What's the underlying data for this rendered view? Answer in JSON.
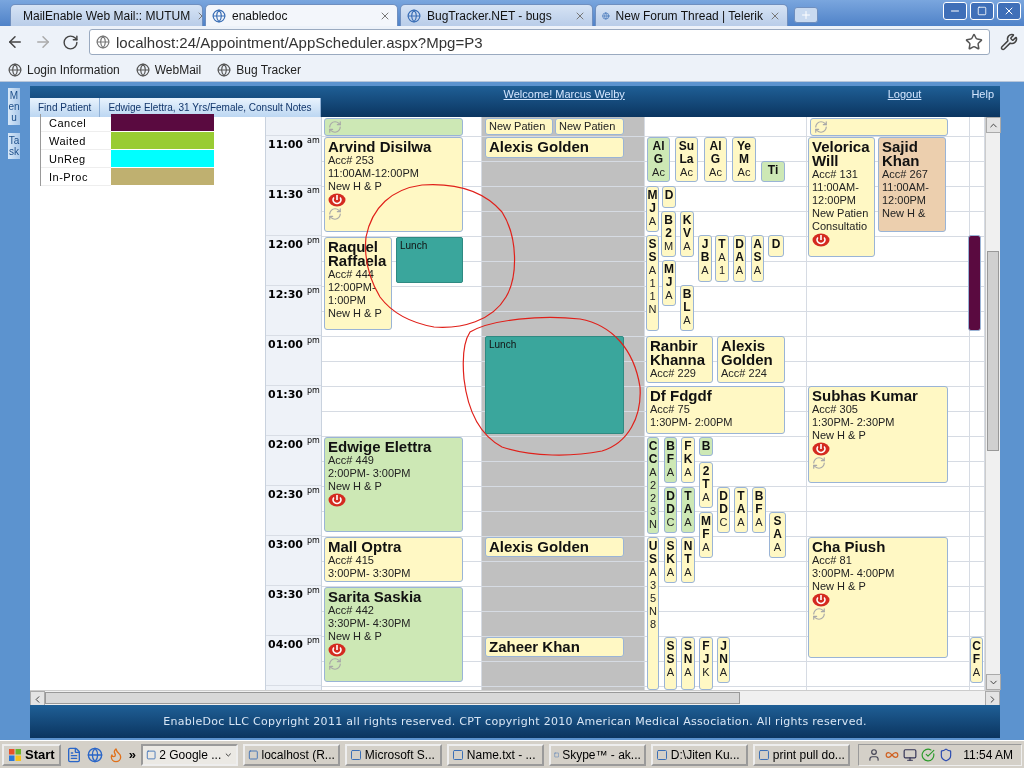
{
  "browser": {
    "tabs": [
      {
        "title": "MailEnable Web Mail:: MUTUM",
        "selected": false
      },
      {
        "title": "enabledoc",
        "selected": true
      },
      {
        "title": "BugTracker.NET - bugs",
        "selected": false
      },
      {
        "title": "New Forum Thread | Telerik",
        "selected": false
      }
    ],
    "url": "localhost:24/Appointment/AppScheduler.aspx?Mpg=P3",
    "bookmarks": [
      "Login Information",
      "WebMail",
      "Bug Tracker"
    ]
  },
  "side_strip": [
    "Menu",
    "Task"
  ],
  "header": {
    "links": [
      "Find Patient",
      "Edwige Elettra, 31 Yrs/Female, Consult Notes"
    ],
    "welcome": "Welcome! Marcus Welby",
    "logout": "Logout",
    "help": "Help"
  },
  "legend": [
    {
      "label": "Cancel",
      "color": "#5a0a40"
    },
    {
      "label": "Waited",
      "color": "#99cc33"
    },
    {
      "label": "UnReg",
      "color": "#00ffff"
    },
    {
      "label": "In-Proc",
      "color": "#bfb070"
    }
  ],
  "time_slots": [
    {
      "time": "11:00",
      "period": "am"
    },
    {
      "time": "11:30",
      "period": "am"
    },
    {
      "time": "12:00",
      "period": "pm"
    },
    {
      "time": "12:30",
      "period": "pm"
    },
    {
      "time": "01:00",
      "period": "pm"
    },
    {
      "time": "01:30",
      "period": "pm"
    },
    {
      "time": "02:00",
      "period": "pm"
    },
    {
      "time": "02:30",
      "period": "pm"
    },
    {
      "time": "03:00",
      "period": "pm"
    },
    {
      "time": "03:30",
      "period": "pm"
    },
    {
      "time": "04:00",
      "period": "pm"
    }
  ],
  "appointments": [
    {
      "kind": "card",
      "color": "#cde8b5",
      "alert": false,
      "recurring": true
    },
    {
      "kind": "card",
      "color": "#fff8c4",
      "details": [
        "New Patien"
      ],
      "alert": false,
      "recurring": false
    },
    {
      "kind": "card",
      "color": "#fff8c4",
      "details": [
        "New Patien"
      ],
      "alert": false,
      "recurring": false
    },
    {
      "kind": "card",
      "color": "#fff8c4",
      "alert": false,
      "recurring": true
    },
    {
      "kind": "card",
      "color": "#fff8c4",
      "name": "Arvind Disilwa",
      "details": [
        "Acc# 253",
        "11:00AM-12:00PM",
        "New H & P"
      ],
      "alert": true,
      "recurring": true
    },
    {
      "kind": "card",
      "color": "#fff8c4",
      "name": "Alexis Golden",
      "alert": false,
      "recurring": false
    },
    {
      "kind": "mini",
      "color": "#cde8b5",
      "name_lines": [
        "Al",
        "G"
      ],
      "detail_lines": [
        "Ac"
      ]
    },
    {
      "kind": "mini",
      "color": "#fff8c4",
      "name_lines": [
        "Su",
        "La"
      ],
      "detail_lines": [
        "Ac"
      ]
    },
    {
      "kind": "mini",
      "color": "#fff8c4",
      "name_lines": [
        "Al",
        "G"
      ],
      "detail_lines": [
        "Ac"
      ]
    },
    {
      "kind": "mini",
      "color": "#fff8c4",
      "name_lines": [
        "Ye",
        "M"
      ],
      "detail_lines": [
        "Ac"
      ]
    },
    {
      "kind": "mini",
      "color": "#cde8b5",
      "name_lines": [
        "Ti"
      ]
    },
    {
      "kind": "card",
      "color": "#fff8c4",
      "name": "Velorica Will",
      "details": [
        "Acc# 131",
        "11:00AM-12:00PM",
        "New Patien",
        "Consultatio"
      ],
      "alert": true,
      "recurring": false
    },
    {
      "kind": "card",
      "color": "#eccfae",
      "name": "Sajid Khan",
      "details": [
        "Acc# 267",
        "11:00AM-12:00PM",
        "New H &"
      ],
      "alert": false,
      "recurring": false
    },
    {
      "kind": "mini",
      "color": "#fff8c4",
      "name_lines": [
        "M",
        "J"
      ],
      "detail_lines": [
        "A"
      ]
    },
    {
      "kind": "mini",
      "color": "#fff8c4",
      "name_lines": [
        "D"
      ]
    },
    {
      "kind": "mini",
      "color": "#fff8c4",
      "name_lines": [
        "B",
        "2"
      ],
      "detail_lines": [
        "M"
      ]
    },
    {
      "kind": "mini",
      "color": "#fff8c4",
      "name_lines": [
        "K",
        "V"
      ],
      "detail_lines": [
        "A"
      ]
    },
    {
      "kind": "card",
      "color": "#fff8c4",
      "name": "Raquel Raffaela",
      "details": [
        "Acc# 444",
        "12:00PM-1:00PM",
        "New H & P"
      ],
      "alert": false,
      "recurring": false
    },
    {
      "kind": "lunch",
      "color": "#3aa69c",
      "label": "Lunch"
    },
    {
      "kind": "mini",
      "color": "#fff8c4",
      "name_lines": [
        "S",
        "S"
      ],
      "detail_lines": [
        "A",
        "1",
        "1",
        "N"
      ]
    },
    {
      "kind": "mini",
      "color": "#fff8c4",
      "name_lines": [
        "M",
        "J"
      ],
      "detail_lines": [
        "A"
      ]
    },
    {
      "kind": "mini",
      "color": "#fff8c4",
      "name_lines": [
        "J",
        "B"
      ],
      "detail_lines": [
        "A"
      ]
    },
    {
      "kind": "mini",
      "color": "#fff8c4",
      "name_lines": [
        "T"
      ],
      "detail_lines": [
        "A",
        "1"
      ]
    },
    {
      "kind": "mini",
      "color": "#fff8c4",
      "name_lines": [
        "D",
        "A"
      ],
      "detail_lines": [
        "A"
      ]
    },
    {
      "kind": "mini",
      "color": "#fff8c4",
      "name_lines": [
        "A",
        "S"
      ],
      "detail_lines": [
        "A"
      ]
    },
    {
      "kind": "mini",
      "color": "#fff8c4",
      "name_lines": [
        "D"
      ]
    },
    {
      "kind": "mini",
      "color": "#fff8c4",
      "name_lines": [
        "B",
        "L"
      ],
      "detail_lines": [
        "A"
      ]
    },
    {
      "kind": "mini",
      "color": "#5a0a40"
    },
    {
      "kind": "lunch",
      "color": "#3aa69c",
      "label": "Lunch"
    },
    {
      "kind": "card",
      "color": "#fff8c4",
      "name": "Ranbir Khanna",
      "details": [
        "Acc# 229"
      ],
      "alert": false,
      "recurring": false
    },
    {
      "kind": "card",
      "color": "#fff8c4",
      "name": "Alexis Golden",
      "details": [
        "Acc# 224"
      ],
      "alert": false,
      "recurring": false
    },
    {
      "kind": "card",
      "color": "#fff8c4",
      "name": "Df Fdgdf",
      "details": [
        "Acc# 75",
        "1:30PM- 2:00PM"
      ],
      "alert": false,
      "recurring": false
    },
    {
      "kind": "card",
      "color": "#fff8c4",
      "name": "Subhas Kumar",
      "details": [
        "Acc# 305",
        "1:30PM- 2:30PM",
        "New H & P"
      ],
      "alert": true,
      "recurring": true
    },
    {
      "kind": "card",
      "color": "#cde8b5",
      "name": "Edwige Elettra",
      "details": [
        "Acc# 449",
        "2:00PM- 3:00PM",
        "New H & P"
      ],
      "alert": true,
      "recurring": false
    },
    {
      "kind": "mini",
      "color": "#cde8b5",
      "name_lines": [
        "C",
        "C"
      ],
      "detail_lines": [
        "A",
        "2",
        "2",
        "3",
        "N"
      ]
    },
    {
      "kind": "mini",
      "color": "#cde8b5",
      "name_lines": [
        "B",
        "F"
      ],
      "detail_lines": [
        "A"
      ]
    },
    {
      "kind": "mini",
      "color": "#fff8c4",
      "name_lines": [
        "F",
        "K"
      ],
      "detail_lines": [
        "A"
      ]
    },
    {
      "kind": "mini",
      "color": "#cde8b5",
      "name_lines": [
        "B"
      ]
    },
    {
      "kind": "mini",
      "color": "#fff8c4",
      "name_lines": [
        "2",
        "T"
      ],
      "detail_lines": [
        "A"
      ]
    },
    {
      "kind": "mini",
      "color": "#cde8b5",
      "name_lines": [
        "D",
        "D"
      ],
      "detail_lines": [
        "C"
      ]
    },
    {
      "kind": "mini",
      "color": "#cde8b5",
      "name_lines": [
        "T",
        "A"
      ],
      "detail_lines": [
        "A"
      ]
    },
    {
      "kind": "mini",
      "color": "#fff8c4",
      "name_lines": [
        "M",
        "F"
      ],
      "detail_lines": [
        "A"
      ]
    },
    {
      "kind": "mini",
      "color": "#fff8c4",
      "name_lines": [
        "D",
        "D"
      ],
      "detail_lines": [
        "C"
      ]
    },
    {
      "kind": "mini",
      "color": "#fff8c4",
      "name_lines": [
        "T",
        "A"
      ],
      "detail_lines": [
        "A"
      ]
    },
    {
      "kind": "mini",
      "color": "#fff8c4",
      "name_lines": [
        "B",
        "F"
      ],
      "detail_lines": [
        "A"
      ]
    },
    {
      "kind": "mini",
      "color": "#fff8c4",
      "name_lines": [
        "S",
        "A"
      ],
      "detail_lines": [
        "A"
      ]
    },
    {
      "kind": "card",
      "color": "#fff8c4",
      "name": "Mall Optra",
      "details": [
        "Acc# 415",
        "3:00PM- 3:30PM"
      ],
      "alert": false,
      "recurring": false
    },
    {
      "kind": "card",
      "color": "#fff8c4",
      "name": "Alexis Golden",
      "alert": false,
      "recurring": false
    },
    {
      "kind": "mini",
      "color": "#fff8c4",
      "name_lines": [
        "U",
        "S"
      ],
      "detail_lines": [
        "A",
        "3",
        "5",
        "N",
        "8"
      ]
    },
    {
      "kind": "mini",
      "color": "#fff8c4",
      "name_lines": [
        "S",
        "K"
      ],
      "detail_lines": [
        "A"
      ]
    },
    {
      "kind": "mini",
      "color": "#fff8c4",
      "name_lines": [
        "N",
        "T"
      ],
      "detail_lines": [
        "A"
      ]
    },
    {
      "kind": "card",
      "color": "#fff8c4",
      "name": "Cha Piush",
      "details": [
        "Acc# 81",
        "3:00PM- 4:00PM",
        "New H & P"
      ],
      "alert": true,
      "recurring": true
    },
    {
      "kind": "card",
      "color": "#cde8b5",
      "name": "Sarita Saskia",
      "details": [
        "Acc# 442",
        "3:30PM- 4:30PM",
        "New H & P"
      ],
      "alert": true,
      "recurring": true
    },
    {
      "kind": "card",
      "color": "#fff8c4",
      "name": "Zaheer Khan",
      "alert": false,
      "recurring": false
    },
    {
      "kind": "mini",
      "color": "#fff8c4",
      "name_lines": [
        "S",
        "S"
      ],
      "detail_lines": [
        "A"
      ]
    },
    {
      "kind": "mini",
      "color": "#fff8c4",
      "name_lines": [
        "S",
        "N"
      ],
      "detail_lines": [
        "A"
      ]
    },
    {
      "kind": "mini",
      "color": "#fff8c4",
      "name_lines": [
        "F",
        "J"
      ],
      "detail_lines": [
        "K"
      ]
    },
    {
      "kind": "mini",
      "color": "#fff8c4",
      "name_lines": [
        "J",
        "N"
      ],
      "detail_lines": [
        "A"
      ]
    },
    {
      "kind": "mini",
      "color": "#fff8c4",
      "name_lines": [
        "C",
        "F"
      ],
      "detail_lines": [
        "A"
      ]
    }
  ],
  "footer": "EnableDoc LLC Copyright 2011 all rights reserved. CPT copyright 2010 American Medical Association. All rights reserved.",
  "taskbar": {
    "start": "Start",
    "more": "»",
    "items": [
      {
        "label": "2 Google ...",
        "selected": true,
        "grouped": true
      },
      {
        "label": "localhost (R...",
        "selected": false,
        "grouped": false
      },
      {
        "label": "Microsoft S...",
        "selected": false,
        "grouped": false
      },
      {
        "label": "Name.txt - ...",
        "selected": false,
        "grouped": false
      },
      {
        "label": "Skype™ - ak...",
        "selected": false,
        "grouped": false
      },
      {
        "label": "D:\\Jiten Ku...",
        "selected": false,
        "grouped": false
      },
      {
        "label": "print pull do...",
        "selected": false,
        "grouped": false
      }
    ],
    "clock": "11:54 AM"
  }
}
